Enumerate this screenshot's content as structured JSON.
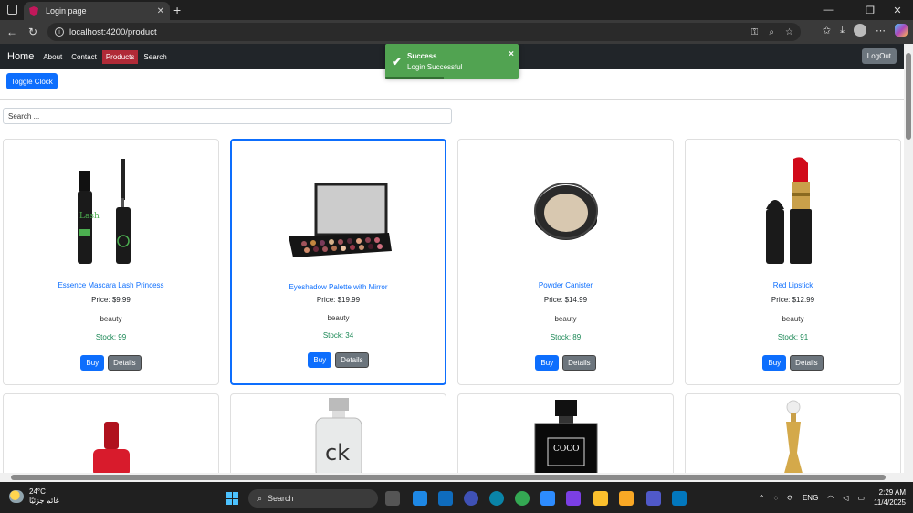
{
  "browser": {
    "tab_title": "Login page",
    "url": "localhost:4200/product"
  },
  "app": {
    "brand": "Home",
    "nav": [
      "About",
      "Contact",
      "Products",
      "Search"
    ],
    "active_nav": "Products",
    "logout": "LogOut",
    "toggle_clock": "Toggle Clock",
    "search_placeholder": "Search ..."
  },
  "toast": {
    "title": "Success",
    "message": "Login Successful"
  },
  "products": [
    {
      "name": "Essence Mascara Lash Princess",
      "price": "Price: $9.99",
      "category": "beauty",
      "stock": "Stock: 99",
      "image": "mascara"
    },
    {
      "name": "Eyeshadow Palette with Mirror",
      "price": "Price: $19.99",
      "category": "beauty",
      "stock": "Stock: 34",
      "image": "palette"
    },
    {
      "name": "Powder Canister",
      "price": "Price: $14.99",
      "category": "beauty",
      "stock": "Stock: 89",
      "image": "powder"
    },
    {
      "name": "Red Lipstick",
      "price": "Price: $12.99",
      "category": "beauty",
      "stock": "Stock: 91",
      "image": "lipstick"
    }
  ],
  "buttons": {
    "buy": "Buy",
    "details": "Details"
  },
  "taskbar": {
    "weather_temp": "24°C",
    "weather_desc": "غائم جزئيًا",
    "search": "Search",
    "lang": "ENG",
    "time": "2:29 AM",
    "date": "11/4/2025"
  },
  "colors": {
    "primary": "#0d6efd",
    "active_nav": "#b02a37",
    "toast": "#51a351",
    "stock": "#198754"
  }
}
